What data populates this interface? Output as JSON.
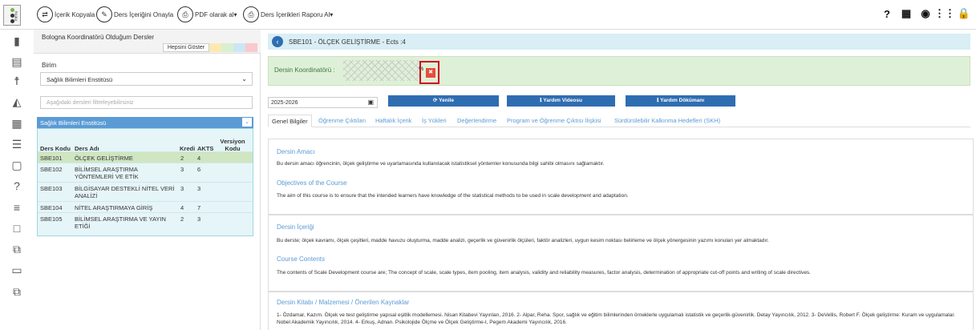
{
  "toolbar": {
    "menu_label": "menu",
    "copy_label": "İçerik Kopyala",
    "approve_label": "Ders İçeriğini Onayla",
    "pdf_label": "PDF olarak al",
    "report_label": "Ders İçerikleri Raporu Al"
  },
  "left": {
    "title": "Bologna Koordinatörü Olduğum Dersler",
    "show_all": "Hepsini Göster",
    "swatch_colors": [
      "#fce9b2",
      "#d8f0d0",
      "#cde6f5",
      "#f8c9cf"
    ],
    "birim_label": "Birim",
    "birim_value": "Sağlık Bilimleri Enstitüsü",
    "filter_placeholder": "Aşağıdaki dersleri filtreleyebilirsiniz",
    "institute": "Sağlık Bilimleri Enstitüsü",
    "columns": {
      "code": "Ders Kodu",
      "name": "Ders Adı",
      "credit": "Kredi",
      "akts": "AKTS",
      "version": "Versiyon Kodu"
    },
    "rows": [
      {
        "code": "SBE101",
        "name": "ÖLÇEK GELİŞTİRME",
        "credit": "2",
        "akts": "4"
      },
      {
        "code": "SBE102",
        "name": "BİLİMSEL ARAŞTIRMA YÖNTEMLERİ VE ETİK",
        "credit": "3",
        "akts": "6"
      },
      {
        "code": "SBE103",
        "name": "BİLGİSAYAR DESTEKLİ NİTEL VERİ ANALİZİ",
        "credit": "3",
        "akts": "3"
      },
      {
        "code": "SBE104",
        "name": "NİTEL ARAŞTIRMAYA GİRİŞ",
        "credit": "4",
        "akts": "7"
      },
      {
        "code": "SBE105",
        "name": "BİLİMSEL ARAŞTIRMA VE YAYIN ETİĞİ",
        "credit": "2",
        "akts": "3"
      }
    ]
  },
  "main": {
    "title": "SBE101 - ÖLÇEK GELİŞTİRME - Ects :4",
    "coord_label": "Dersin Koordinatörü :",
    "coord_pct": "%",
    "year": "2025-2026",
    "refresh": "Yenile",
    "help_video": "Yardım Videosu",
    "help_doc": "Yardım Dökümanı",
    "tabs": [
      "Genel Bilgiler",
      "Öğrenme Çıktıları",
      "Haftalık İçerik",
      "İş Yükleri",
      "Değerlendirme",
      "Program ve Öğrenme Çıktısı İlişkisi",
      "Sürdürülebilir Kalkınma Hedefleri (SKH)"
    ],
    "sections": {
      "aim_h": "Dersin Amacı",
      "aim_t": "Bu dersin amacı öğrencinin, ölçek geliştirme ve uyarlamasında kullanılacak istatistiksel yöntemler konusunda bilgi sahibi olmasını sağlamaktır.",
      "obj_h": "Objectives of the Course",
      "obj_t": "The aim of this course is to ensure that the intended learners have knowledge of the statistical methods to be used in scale development and adaptation.",
      "content_h": "Dersin İçeriği",
      "content_t": "Bu derste; ölçek kavramı, ölçek çeşitleri, madde havuzu oluşturma, madde analizi, geçerlik ve güvenirlik ölçüleri, faktör analizleri, uygun kesim noktası belirleme ve ölçek yönergesinin yazımı konuları yer almaktadır.",
      "cc_h": "Course Contents",
      "cc_t": "The contents of Scale Development course are; The concept of scale, scale types, item pooling, item analysis, validity and reliability measures, factor analysis, determination of appropriate cut-off points and writing of scale directives.",
      "books_h": "Dersin Kitabı / Malzemesi / Önerilen Kaynaklar",
      "books_t": "1- Özdamar, Kazım. Ölçek ve test geliştirme yapısal eşitlik modellemesi. Nisan Kitabevi Yayınları, 2016. 2- Alpar, Reha. Spor, sağlık ve eğitim bilimlerinden örneklerle uygulamalı istatistik ve geçerlik-güvenirlik. Detay Yayıncılık, 2012. 3- DeVellis, Robert F. Ölçek geliştirme: Kuram ve uygulamalar. Nobel Akademik Yayıncılık, 2014. 4- Erkuş, Adnan. Psikolojide Ölçme ve Ölçek Geliştirme-I, Pegem Akademi Yayıncılık, 2016."
    }
  }
}
